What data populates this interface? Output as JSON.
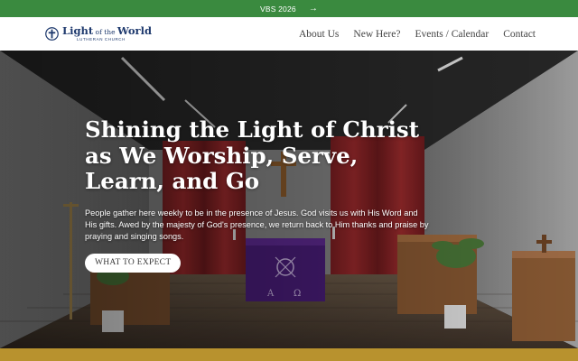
{
  "announcement": {
    "text": "VBS 2026",
    "arrow_icon": "arrow-right-icon"
  },
  "header": {
    "logo": {
      "title_big": "Light",
      "title_small": " of the ",
      "title_end": "World",
      "subtitle": "LUTHERAN CHURCH",
      "icon": "cross-shield-icon"
    },
    "nav": [
      {
        "label": "About Us"
      },
      {
        "label": "New Here?"
      },
      {
        "label": "Events / Calendar"
      },
      {
        "label": "Contact"
      }
    ]
  },
  "hero": {
    "title": "Shining the Light of Christ as We Worship, Serve, Learn, and Go",
    "body": "People gather here weekly to be in the presence of Jesus. God visits us with His Word and His gifts. Awed by the majesty of God's presence, we return back to Him thanks and praise by praying and singing songs.",
    "cta": "WHAT TO EXPECT"
  },
  "colors": {
    "announce_bg": "#3a8a3f",
    "brand_navy": "#1f3a6e",
    "gold_band": "#b8922e",
    "altar_purple": "#4a1d7a"
  }
}
